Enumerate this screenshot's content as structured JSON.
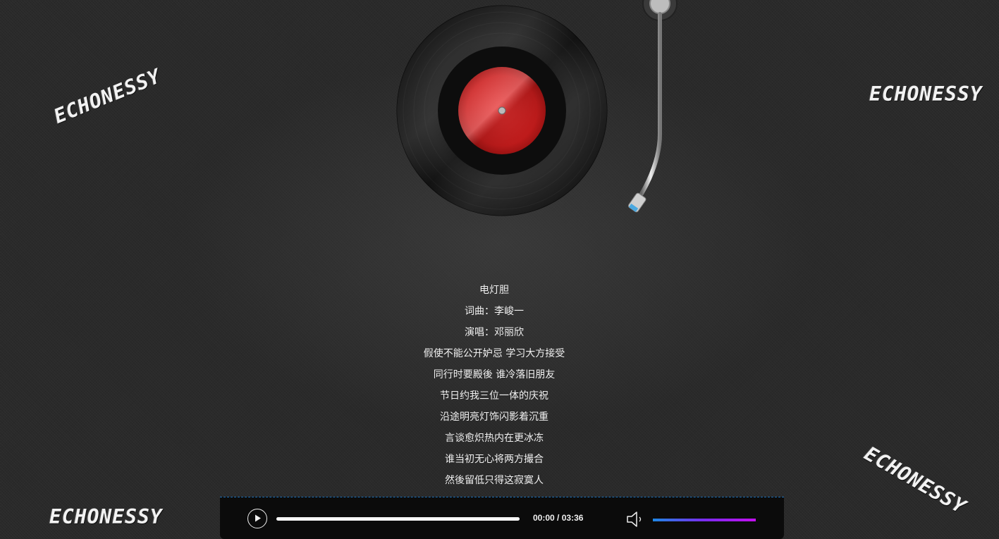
{
  "brand": {
    "top_left": "ECHONESSY",
    "top_right": "ECHONESSY",
    "bottom_left": "ECHONESSY",
    "bottom_right": "ECHONESSY"
  },
  "lyrics": [
    "电灯胆",
    "词曲：李峻一",
    "演唱：邓丽欣",
    "假使不能公开妒忌 学习大方接受",
    "同行时要殿後 谁冷落旧朋友",
    "节日约我三位一体的庆祝",
    "沿途明亮灯饰闪影着沉重",
    "言谈愈炽热内在更冰冻",
    "谁当初无心将两方撮合",
    "然後留低只得这寂寞人"
  ],
  "player": {
    "state": "paused",
    "current_time": "00:00",
    "separator": " / ",
    "duration": "03:36",
    "progress_fraction": 1.0,
    "volume_fraction": 1.0
  },
  "icons": {
    "play": "play-icon",
    "volume": "speaker-icon",
    "record": "vinyl-record-icon",
    "tonearm": "tonearm-icon"
  },
  "colors": {
    "background": "#2a2a2a",
    "label_red": "#d42020",
    "volume_gradient_start": "#1e88e5",
    "volume_gradient_end": "#c40ff0",
    "player_border": "#1d6fb7"
  }
}
